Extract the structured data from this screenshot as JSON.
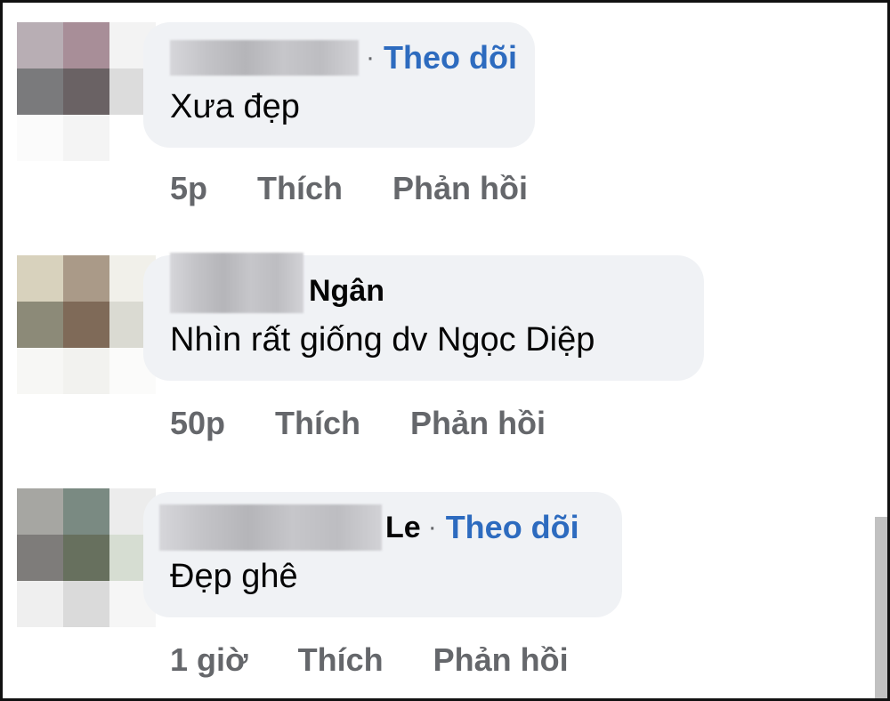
{
  "comments": [
    {
      "name_suffix": "",
      "dot": "·",
      "follow": "Theo dõi",
      "text": "Xưa đẹp",
      "time": "5p",
      "like": "Thích",
      "reply": "Phản hồi"
    },
    {
      "name_suffix": "Ngân",
      "dot": "",
      "follow": "",
      "text": "Nhìn rất giống dv Ngọc Diệp",
      "time": "50p",
      "like": "Thích",
      "reply": "Phản hồi"
    },
    {
      "name_suffix": "Le",
      "dot": "·",
      "follow": "Theo dõi",
      "text": "Đẹp ghê",
      "time": "1 giờ",
      "like": "Thích",
      "reply": "Phản hồi"
    }
  ],
  "colors": {
    "follow_link": "#2d6bbf",
    "bubble_bg": "#f0f2f5",
    "meta_text": "#65676b"
  }
}
